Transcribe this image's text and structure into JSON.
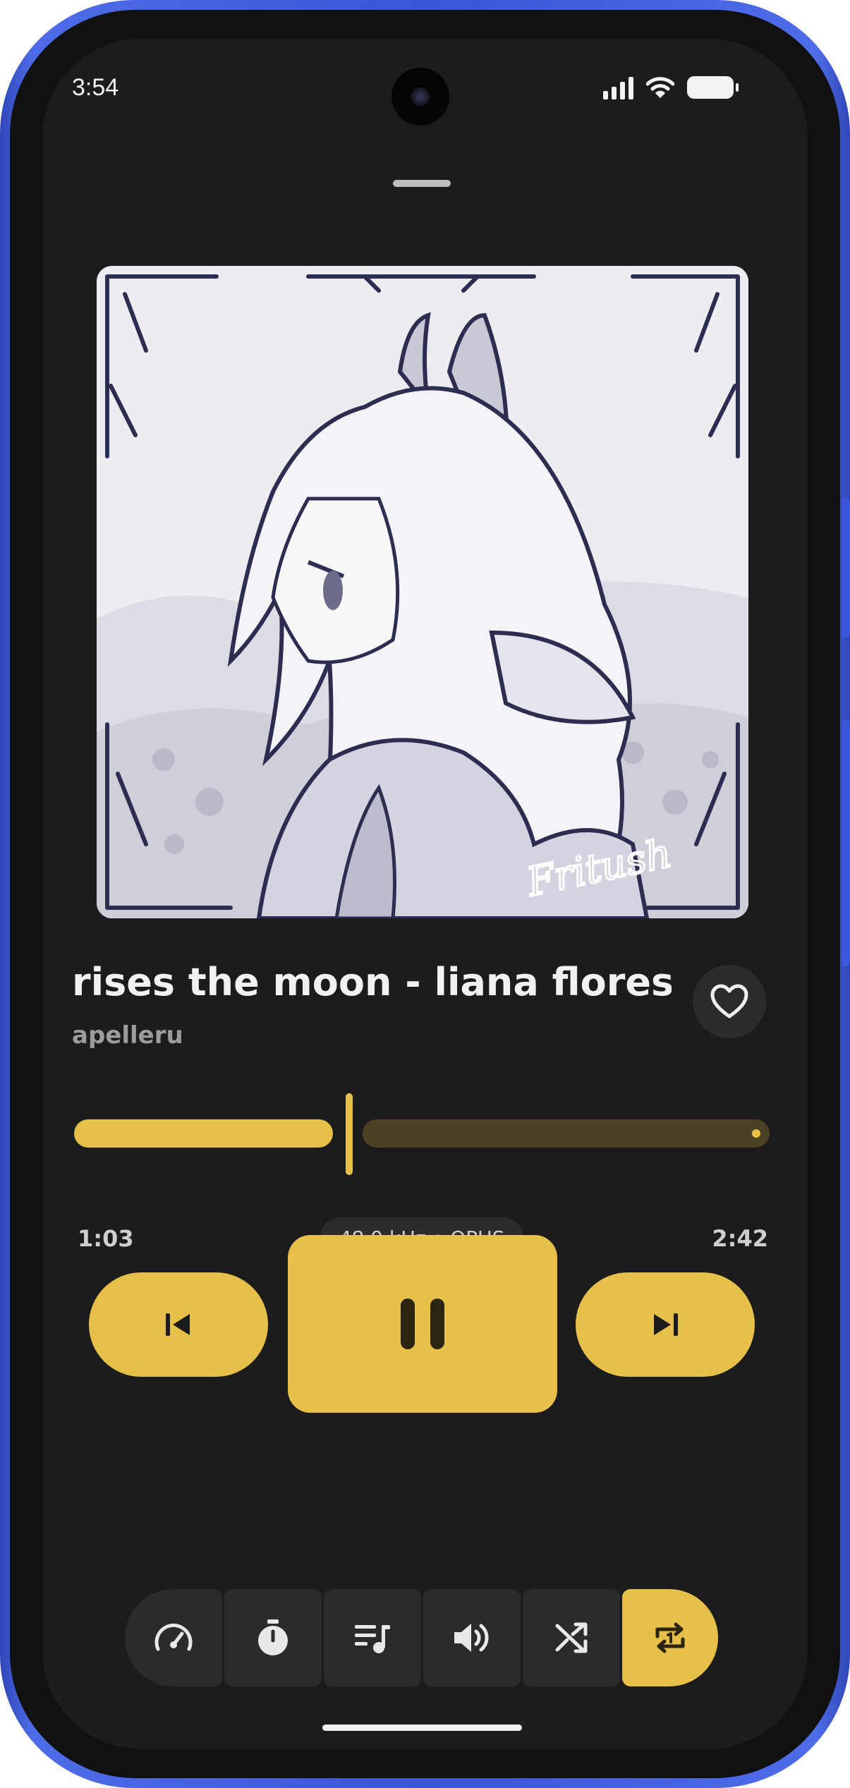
{
  "status_bar": {
    "time": "3:54",
    "icons": [
      "signal-icon",
      "wifi-icon",
      "battery-icon"
    ]
  },
  "artwork": {
    "watermark": "Fritush"
  },
  "track": {
    "title": "rises the moon - liana flores / Cover",
    "artist": "apelleru",
    "favorite": false
  },
  "playback": {
    "current_time": "1:03",
    "total_time": "2:42",
    "progress": 0.39,
    "format": "48.0 kHz • OPUS",
    "state": "playing"
  },
  "controls": {
    "previous": "skip-previous-icon",
    "play_pause": "pause-icon",
    "next": "skip-next-icon"
  },
  "toolbar": {
    "items": [
      {
        "icon": "speed-icon",
        "active": false
      },
      {
        "icon": "sleep-timer-icon",
        "active": false
      },
      {
        "icon": "queue-icon",
        "active": false
      },
      {
        "icon": "volume-icon",
        "active": false
      },
      {
        "icon": "shuffle-icon",
        "active": false
      },
      {
        "icon": "repeat-one-icon",
        "active": true
      }
    ]
  },
  "colors": {
    "accent": "#e6c048",
    "accent_dark": "#4b4125",
    "background": "#1c1c1c",
    "surface": "#2b2b2b",
    "frame": "#3a55d6"
  }
}
